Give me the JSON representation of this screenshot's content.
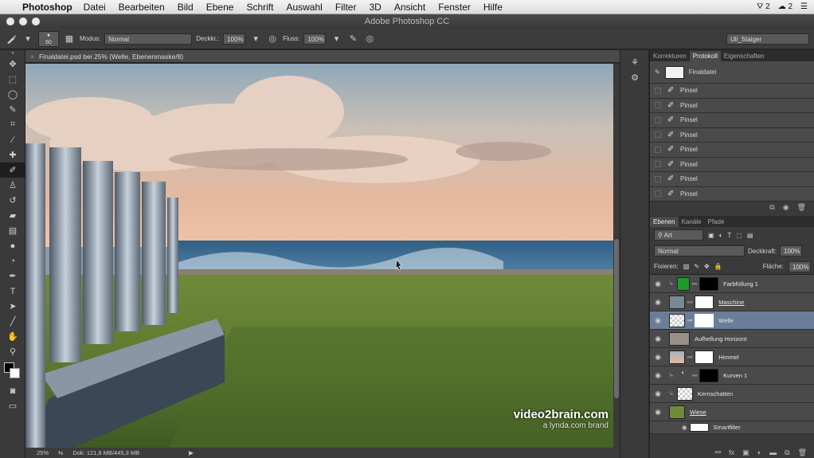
{
  "menubar": {
    "app": "Photoshop",
    "items": [
      "Datei",
      "Bearbeiten",
      "Bild",
      "Ebene",
      "Schrift",
      "Auswahl",
      "Filter",
      "3D",
      "Ansicht",
      "Fenster",
      "Hilfe"
    ],
    "status_count": "2",
    "cc_count": "2"
  },
  "window": {
    "title": "Adobe Photoshop CC"
  },
  "options": {
    "brush_size": "60",
    "mode_label": "Modus:",
    "mode_value": "Normal",
    "opacity_label": "Deckkr.:",
    "opacity_value": "100%",
    "flow_label": "Fluss:",
    "flow_value": "100%",
    "workspace": "Uli_Staiger"
  },
  "document": {
    "tab_title": "Finaldatei.psd bei 25% (Welle, Ebenenmaske/8)",
    "zoom": "25%",
    "doc_info": "Dok: 121,8 MB/445,3 MB"
  },
  "history_panel": {
    "tabs": [
      "Korrekturen",
      "Protokoll",
      "Eigenschaften"
    ],
    "active_tab": "Protokoll",
    "snapshot": "Finaldatei",
    "steps": [
      "Pinsel",
      "Pinsel",
      "Pinsel",
      "Pinsel",
      "Pinsel",
      "Pinsel",
      "Pinsel",
      "Pinsel"
    ]
  },
  "layers_panel": {
    "tabs": [
      "Ebenen",
      "Kanäle",
      "Pfade"
    ],
    "active_tab": "Ebenen",
    "filter": "Art",
    "blend_mode": "Normal",
    "opacity_label": "Deckkraft:",
    "opacity_value": "100%",
    "lock_label": "Fixieren:",
    "fill_label": "Fläche:",
    "fill_value": "100%",
    "layers": [
      {
        "name": "Farbfüllung 1",
        "selected": false
      },
      {
        "name": "Maschine",
        "selected": false
      },
      {
        "name": "Welle",
        "selected": true
      },
      {
        "name": "Aufhellung Horizont",
        "selected": false
      },
      {
        "name": "Himmel",
        "selected": false
      },
      {
        "name": "Kurven 1",
        "selected": false
      },
      {
        "name": "Kernschatten",
        "selected": false
      },
      {
        "name": "Wiese",
        "selected": false
      }
    ],
    "smartfilter": "Smartfilter"
  },
  "watermark": {
    "brand": "video2brain.com",
    "sub": "a lynda.com brand"
  },
  "colors": {
    "selected_layer": "#6a7e9a",
    "panel_bg": "#4a4a4a",
    "ui_dark": "#282828"
  },
  "icons": [
    "apple-icon",
    "brush-icon",
    "airbrush-icon",
    "eye-icon",
    "lock-icon",
    "chain-icon",
    "trash-icon",
    "camera-icon",
    "new-layer-icon",
    "fx-icon"
  ]
}
